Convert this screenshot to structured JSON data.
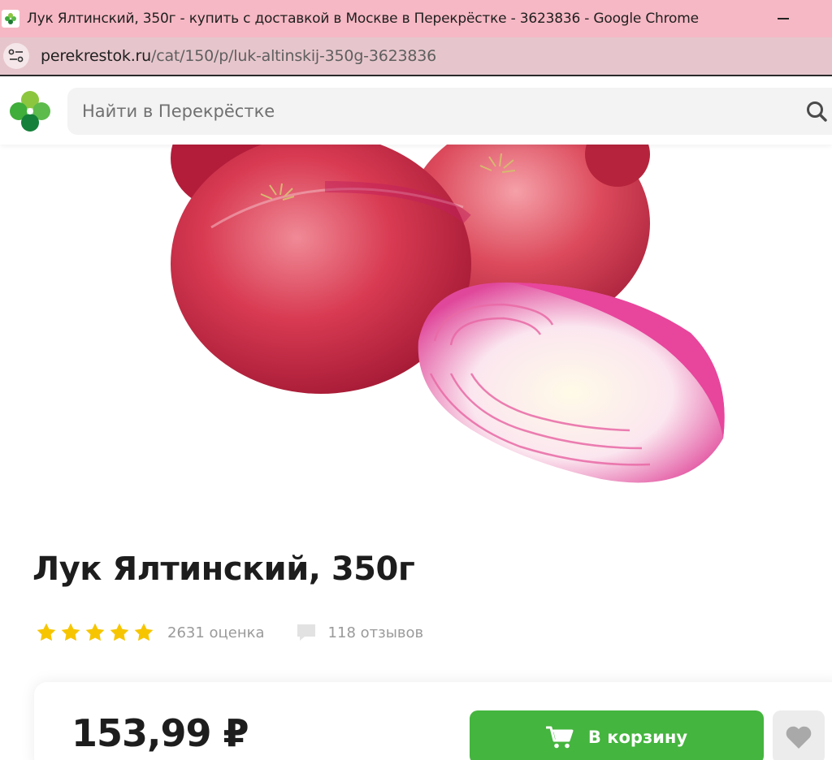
{
  "browser": {
    "window_title": "Лук Ялтинский, 350г - купить с доставкой в Москве в Перекрёстке - 3623836 - Google Chrome",
    "url_domain": "perekrestok.ru",
    "url_path": "/cat/150/p/luk-altinskij-350g-3623836",
    "icons": {
      "favicon": "perekrestok-favicon-icon",
      "minimize": "minimize-icon",
      "site_info": "site-info-icon"
    }
  },
  "header": {
    "logo": "perekrestok-logo-icon",
    "search": {
      "placeholder": "Найти в Перекрёстке",
      "value": "",
      "icon": "search-icon"
    }
  },
  "product": {
    "image": "red-onion-product-photo",
    "title": "Лук Ялтинский, 350г",
    "rating": {
      "stars_filled": 5,
      "stars_total": 5,
      "count_text": "2631 оценка"
    },
    "reviews": {
      "icon": "comment-icon",
      "count_text": "118 отзывов"
    },
    "price": "153,99 ₽",
    "cart_button": {
      "label": "В корзину",
      "icon": "cart-icon"
    },
    "favorite_button": {
      "icon": "heart-icon"
    }
  },
  "colors": {
    "titlebar_bg": "#f6b8c4",
    "addressbar_bg": "#e6c6cc",
    "brand_green": "#44b53e",
    "star_yellow": "#f7c500",
    "muted_text": "#9a9a9a"
  }
}
